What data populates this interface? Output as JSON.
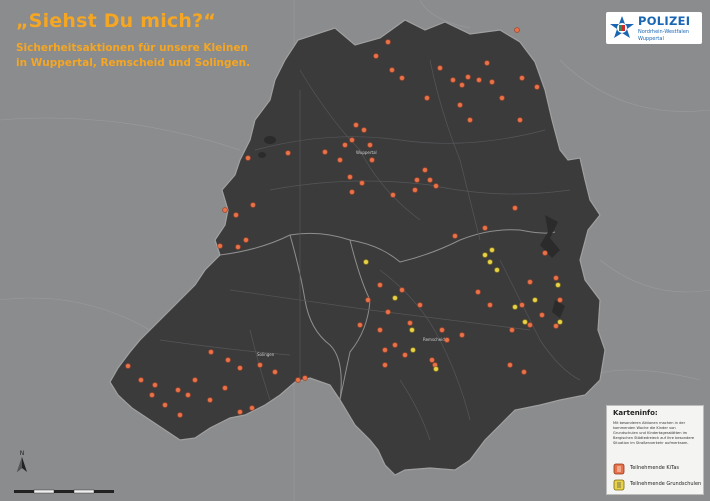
{
  "header": {
    "title": "„Siehst Du mich?“",
    "subtitle_line1": "Sicherheitsaktionen für unsere Kleinen",
    "subtitle_line2": "in Wuppertal, Remscheid und Solingen."
  },
  "logo": {
    "main": "POLIZEI",
    "line1": "Nordrhein-Westfalen",
    "line2": "Wuppertal"
  },
  "place_labels": {
    "wuppertal": "Wuppertal",
    "solingen": "Solingen",
    "remscheid": "Remscheid"
  },
  "legend": {
    "title": "Karteninfo:",
    "description": "Mit besonderen Aktionen machen in der kommenden Woche die Kinder von Grundschulen und Kindertagesstätten im Bergischen Städtedreieck auf ihre besondere Situation im Straßenverkehr aufmerksam.",
    "items": [
      {
        "label": "Teilnehmende KiTas",
        "color": "#e8734a"
      },
      {
        "label": "Teilnehmende Grundschulen",
        "color": "#e8d24a"
      }
    ]
  },
  "compass": {
    "letter": "N"
  },
  "colors": {
    "background": "#8a8c8e",
    "region": "#3c3c3c",
    "accent": "#f5a623",
    "kita": "#e8734a",
    "school": "#e8d24a"
  }
}
